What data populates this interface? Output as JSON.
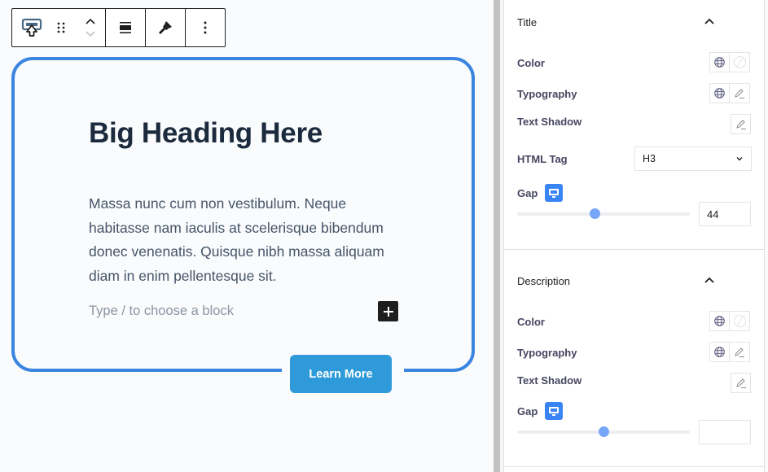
{
  "toolbar": {
    "icons": [
      "block-type-icon",
      "drag-handle-icon",
      "move-up-icon",
      "move-down-icon",
      "align-icon",
      "style-brush-icon",
      "more-options-icon"
    ]
  },
  "canvas": {
    "heading": "Big Heading Here",
    "description": "Massa nunc cum non vestibulum. Neque habitasse nam iaculis at scelerisque bibendum donec venenatis. Quisque nibh massa aliquam diam in enim pellentesque sit.",
    "placeholder": "Type / to choose a block",
    "button_label": "Learn More",
    "accent_color": "#3a85e0",
    "button_color": "#2f9ad9"
  },
  "sidebar": {
    "title_panel": {
      "title": "Title",
      "color_label": "Color",
      "typography_label": "Typography",
      "text_shadow_label": "Text Shadow",
      "html_tag_label": "HTML Tag",
      "html_tag_value": "H3",
      "gap_label": "Gap",
      "gap_value": "44",
      "gap_slider_fraction": 0.45
    },
    "description_panel": {
      "title": "Description",
      "color_label": "Color",
      "typography_label": "Typography",
      "text_shadow_label": "Text Shadow",
      "gap_label": "Gap",
      "gap_value": "",
      "gap_slider_fraction": 0.5
    }
  }
}
